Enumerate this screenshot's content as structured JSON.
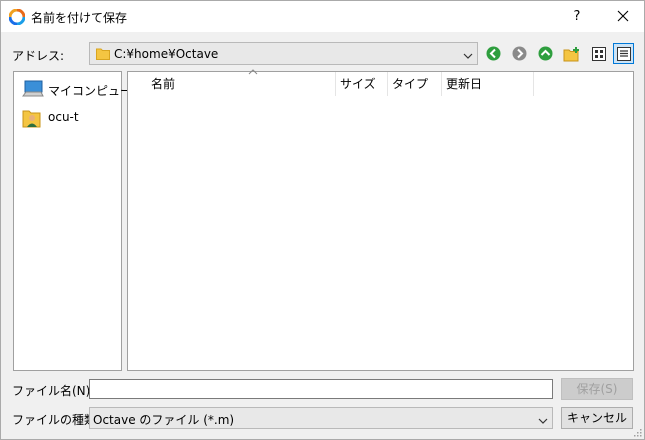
{
  "window": {
    "title": "名前を付けて保存",
    "help_label": "?"
  },
  "address": {
    "label": "アドレス:",
    "path": "C:¥home¥Octave"
  },
  "toolbar": {
    "icons": [
      "back-icon",
      "forward-icon",
      "up-icon",
      "new-folder-icon",
      "icon-view-icon",
      "detail-view-icon"
    ]
  },
  "sidebar": {
    "items": [
      {
        "label": "マイコンピュータ",
        "icon": "computer-icon"
      },
      {
        "label": "ocu-t",
        "icon": "user-folder-icon"
      }
    ]
  },
  "file_list": {
    "columns": [
      "名前",
      "サイズ",
      "タイプ",
      "更新日"
    ],
    "rows": []
  },
  "filename": {
    "label": "ファイル名(N):",
    "value": "",
    "placeholder": ""
  },
  "filetype": {
    "label": "ファイルの種類:",
    "selected": "Octave のファイル (*.m)"
  },
  "buttons": {
    "save": "保存(S)",
    "cancel": "キャンセル"
  },
  "colors": {
    "nav_green": "#2e9e3e",
    "nav_disabled": "#8a8a8a",
    "folder_yellow": "#f4c542",
    "accent_blue": "#0078d7"
  }
}
